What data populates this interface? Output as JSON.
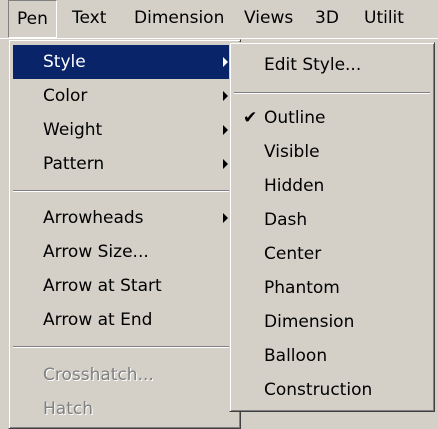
{
  "menubar": {
    "items": [
      "Pen",
      "Text",
      "Dimension",
      "Views",
      "3D",
      "Utilit"
    ]
  },
  "pen_menu": {
    "items": [
      {
        "label": "Style",
        "submenu": true,
        "selected": true
      },
      {
        "label": "Color",
        "submenu": true
      },
      {
        "label": "Weight",
        "submenu": true
      },
      {
        "label": "Pattern",
        "submenu": true
      },
      {
        "label": "Arrowheads",
        "submenu": true
      },
      {
        "label": "Arrow Size..."
      },
      {
        "label": "Arrow at Start"
      },
      {
        "label": "Arrow at End"
      },
      {
        "label": "Crosshatch...",
        "disabled": true
      },
      {
        "label": "Hatch",
        "disabled": true
      }
    ]
  },
  "style_submenu": {
    "edit_label": "Edit Style...",
    "items": [
      {
        "label": "Outline",
        "checked": true
      },
      {
        "label": "Visible"
      },
      {
        "label": "Hidden"
      },
      {
        "label": "Dash"
      },
      {
        "label": "Center"
      },
      {
        "label": "Phantom"
      },
      {
        "label": "Dimension"
      },
      {
        "label": "Balloon"
      },
      {
        "label": "Construction"
      }
    ]
  },
  "colors": {
    "selection": "#0a246a",
    "menu_bg": "#d4d0c8",
    "disabled_text": "#808080"
  },
  "icons": {
    "submenu_arrow": "triangle-right",
    "check": "checkmark"
  }
}
